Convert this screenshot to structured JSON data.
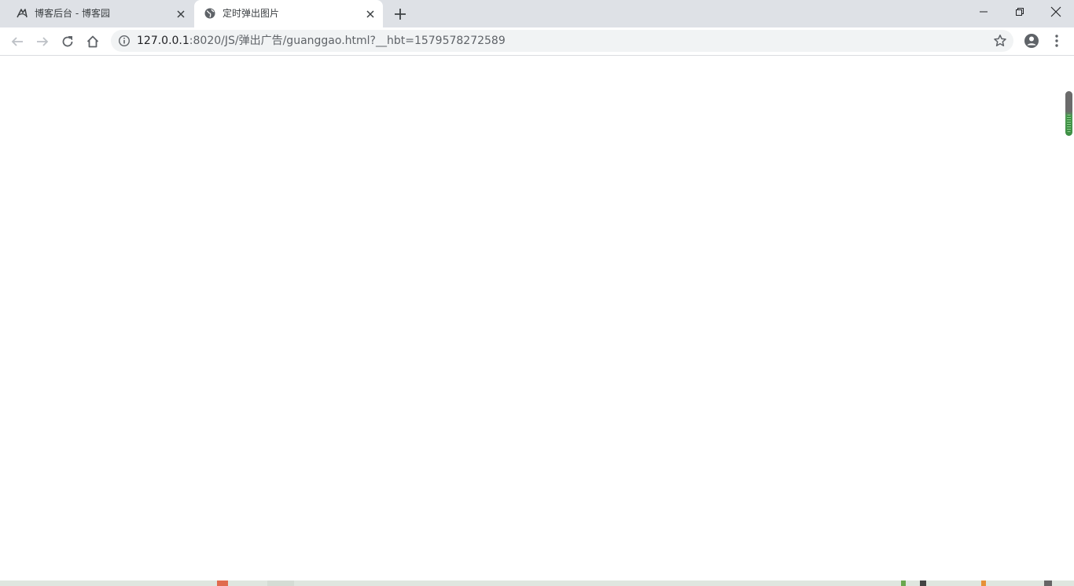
{
  "tabs": [
    {
      "title": "博客后台 - 博客园",
      "favicon": "cnblogs-icon",
      "active": false
    },
    {
      "title": "定时弹出图片",
      "favicon": "globe-icon",
      "active": true
    }
  ],
  "address_bar": {
    "url_host": "127.0.0.1",
    "url_rest": ":8020/JS/弹出广告/guanggao.html?__hbt=1579578272589"
  },
  "colors": {
    "tabstrip": "#dee1e6",
    "omnibox": "#f1f3f4",
    "icon": "#5f6368",
    "scroll_accent": "#3d8f44"
  }
}
